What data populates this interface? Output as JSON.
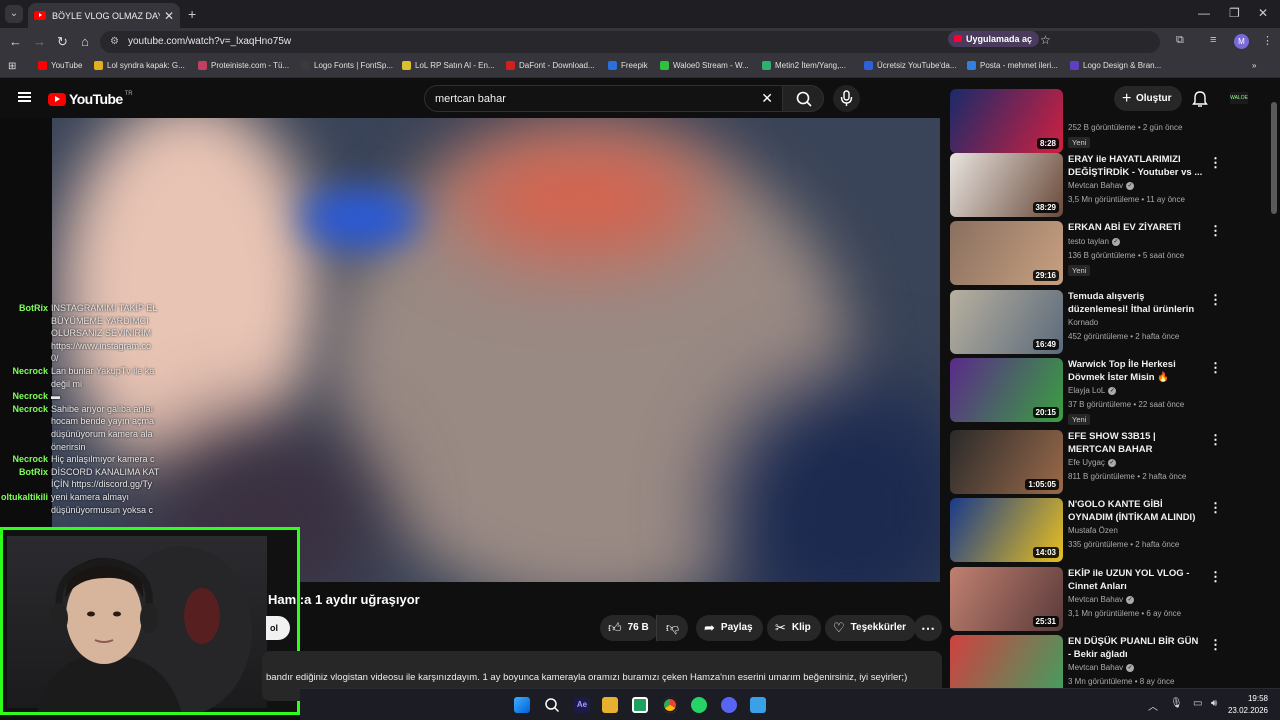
{
  "browser": {
    "tab_title": "BÖYLE VLOG OLMAZ DAYI MISIN",
    "url": "youtube.com/watch?v=_lxaqHno75w",
    "open_in_app": "Uygulamada aç",
    "profile_initial": "M",
    "bookmarks": [
      {
        "label": "YouTube",
        "color": "#ff0000"
      },
      {
        "label": "Lol syndra kapak: G...",
        "color": "#e0b020"
      },
      {
        "label": "Proteiniste.com - Tü...",
        "color": "#c04060"
      },
      {
        "label": "Logo Fonts | FontSp...",
        "color": "#3a3a3a"
      },
      {
        "label": "LoL RP Satın Al - En...",
        "color": "#d8c030"
      },
      {
        "label": "DaFont - Download...",
        "color": "#d02020"
      },
      {
        "label": "Freepik",
        "color": "#2a70d8"
      },
      {
        "label": "Waloe0 Stream - W...",
        "color": "#30c040"
      },
      {
        "label": "Metin2 İtem/Yang,...",
        "color": "#30b070"
      },
      {
        "label": "Ücretsiz YouTube'da...",
        "color": "#3060d8"
      },
      {
        "label": "Posta - mehmet ileri...",
        "color": "#3080e0"
      },
      {
        "label": "Logo Design & Bran...",
        "color": "#6040c0"
      }
    ]
  },
  "youtube": {
    "logo_text": "YouTube",
    "logo_region": "TR",
    "search_query": "mertcan bahar",
    "create_label": "Oluştur",
    "avatar_text": "WALOE"
  },
  "chat": [
    {
      "user": "BotRix",
      "lines": [
        "INSTAGRAMIMI TAKİP EL",
        "BÜYÜMEME YARDIMCI",
        "OLURSANIZ SEVİNİRİM",
        "https://www.instagram.co",
        "0/"
      ]
    },
    {
      "user": "Necrock",
      "lines": [
        "Lan bunlar YakupTv ile ka",
        "değil mi"
      ]
    },
    {
      "user": "Necrock",
      "lines": [
        "▬"
      ]
    },
    {
      "user": "Necrock",
      "lines": [
        "Sahibe arıyor galiba anlaı",
        "hocam bende yayın açma",
        "düşünüyorum kamera ala",
        "önerirsin"
      ]
    },
    {
      "user": "Necrock",
      "lines": [
        "Hiç anlaşılmıyor kamera c"
      ]
    },
    {
      "user": "BotRix",
      "lines": [
        "DİSCORD KANALIMA KAT",
        "İÇİN https://discord.gg/Ty"
      ]
    },
    {
      "user": "oltukaltikili",
      "lines": [
        "yeni kamera almayı",
        "düşünüyormusun yoksa c"
      ]
    }
  ],
  "video": {
    "title": "Ham :a 1 aydır uğraşıyor",
    "subscribe_fragment": "ol",
    "likes": "76 B",
    "share": "Paylaş",
    "clip": "Klip",
    "thanks": "Teşekkürler",
    "description": "bandır   ediğiniz vlogistan videosu ile karşınızdayım. 1 ay boyunca kamerayla oramızı buramızı çeken Hamza'nın eserini umarım beğenirsiniz, iyi seyirler;)"
  },
  "recommendations": [
    {
      "title": "",
      "channel": "",
      "meta": "252 B görüntüleme • 2 gün önce",
      "badge": "Yeni",
      "duration": "8:28",
      "thumb": [
        "#1a2a6a",
        "#d02040"
      ]
    },
    {
      "title": "ERAY ile HAYATLARIMIZI DEĞİŞTİRDİK - Youtuber vs ...",
      "channel": "Mevtcan Bahav",
      "verified": true,
      "meta": "3,5 Mn görüntüleme • 11 ay önce",
      "badge": "",
      "duration": "38:29",
      "thumb": [
        "#e8e4e0",
        "#6a4a3a"
      ]
    },
    {
      "title": "ERKAN ABİ EV ZİYARETİ",
      "channel": "testo taylan",
      "verified": true,
      "meta": "136 B görüntüleme • 5 saat önce",
      "badge": "Yeni",
      "duration": "29:16",
      "thumb": [
        "#8a7060",
        "#c8a080"
      ]
    },
    {
      "title": "Temuda alışveriş düzenlemesi! İthal ürünlerin vatandaşa ...",
      "channel": "Kornado",
      "verified": false,
      "meta": "452 görüntüleme • 2 hafta önce",
      "badge": "",
      "duration": "16:49",
      "thumb": [
        "#b8b0a0",
        "#5a6a7a"
      ]
    },
    {
      "title": "Warwick Top İle Herkesi Dövmek İster Misin 🔥",
      "channel": "Elayja LoL",
      "verified": true,
      "meta": "37 B görüntüleme • 22 saat önce",
      "badge": "Yeni",
      "duration": "20:15",
      "thumb": [
        "#5a2a8a",
        "#3aa040"
      ]
    },
    {
      "title": "EFE SHOW S3B15 | MERTCAN BAHAR",
      "channel": "Efe Uygaç",
      "verified": true,
      "meta": "811 B görüntüleme • 2 hafta önce",
      "badge": "",
      "duration": "1:05:05",
      "thumb": [
        "#2a2a2a",
        "#9a6a4a"
      ]
    },
    {
      "title": "N'GOLO KANTE GİBİ OYNADIM (İNTİKAM ALINDI)",
      "channel": "Mustafa Özen",
      "verified": false,
      "meta": "335 görüntüleme • 2 hafta önce",
      "badge": "",
      "duration": "14:03",
      "thumb": [
        "#1a3a8a",
        "#e8c020"
      ]
    },
    {
      "title": "EKİP ile UZUN YOL VLOG - Cinnet Anları",
      "channel": "Mevtcan Bahav",
      "verified": true,
      "meta": "3,1 Mn görüntüleme • 6 ay önce",
      "badge": "",
      "duration": "25:31",
      "thumb": [
        "#c08070",
        "#5a3a3a"
      ]
    },
    {
      "title": "EN DÜŞÜK PUANLI BİR GÜN - Bekir ağladı",
      "channel": "Mevtcan Bahav",
      "verified": true,
      "meta": "3 Mn görüntüleme • 8 ay önce",
      "badge": "",
      "duration": "",
      "thumb": [
        "#d04040",
        "#40a060"
      ]
    }
  ],
  "taskbar": {
    "time": "19:58",
    "date": "23.02.2026"
  }
}
